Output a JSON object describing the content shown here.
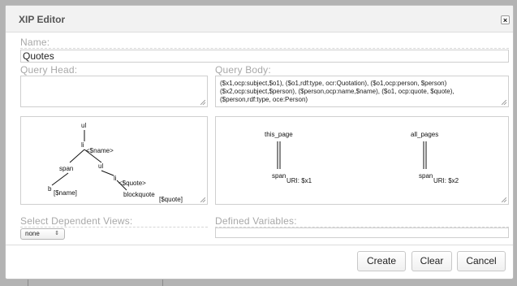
{
  "dialog": {
    "title": "XIP Editor",
    "close_glyph": "×"
  },
  "name": {
    "label": "Name:",
    "value": "Quotes"
  },
  "query_head": {
    "label": "Query Head:",
    "value": ""
  },
  "query_body": {
    "label": "Query Body:",
    "value": "($x1,ocp:subject,$o1), ($o1,rdf:type, ocr:Quotation), ($o1,ocp:person, $person) ($x2,ocp:subject,$person), ($person,ocp:name,$name), ($o1, ocp:quote, $quote), ($person,rdf:type, oce:Person)"
  },
  "head_diagram": {
    "nodes": [
      "ul",
      "li",
      "<$name>",
      "span",
      "ul",
      "b",
      "[$name]",
      "li",
      "<$quote>",
      "blockquote",
      "[$quote]"
    ]
  },
  "body_diagram": {
    "left": {
      "top": "this_page",
      "bottom": "span",
      "uri": "URI: $x1"
    },
    "right": {
      "top": "all_pages",
      "bottom": "span",
      "uri": "URI: $x2"
    }
  },
  "dependent_views": {
    "label": "Select Dependent Views:",
    "selected": "none"
  },
  "defined_variables": {
    "label": "Defined Variables:",
    "value": ""
  },
  "buttons": {
    "create": "Create",
    "clear": "Clear",
    "cancel": "Cancel"
  }
}
